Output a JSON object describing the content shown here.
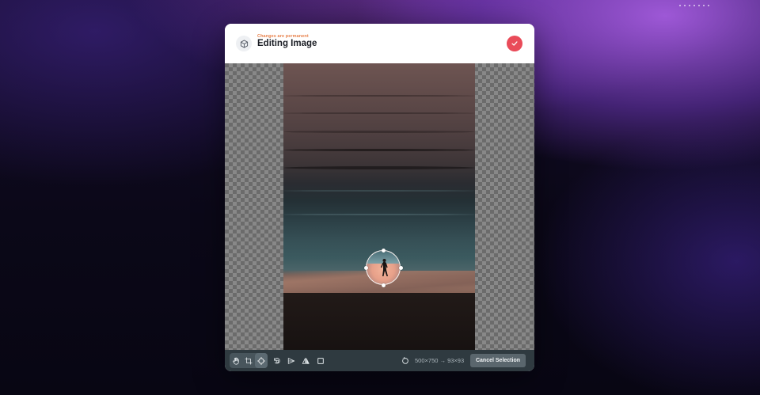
{
  "header": {
    "subtitle": "Changes are permanent",
    "title": "Editing Image",
    "cube_icon": "cube-icon",
    "confirm_icon": "check-icon"
  },
  "toolbar": {
    "tools": [
      "hand-icon",
      "crop-icon",
      "ellipse-select-icon",
      "rotate-left-icon",
      "flip-horizontal-icon",
      "mirror-icon",
      "rectangle-icon"
    ],
    "reset_icon": "reset-icon",
    "dimensions": "500×750 → 93×93",
    "cancel_label": "Cancel Selection"
  },
  "colors": {
    "accent": "#e94b59",
    "subtitle": "#e8824c",
    "toolbar_bg": "#2f3a40",
    "button_bg": "#5a666d"
  }
}
